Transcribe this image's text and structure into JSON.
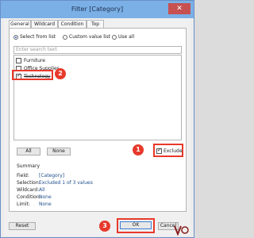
{
  "window": {
    "title": "Filter [Category]",
    "close_glyph": "✕"
  },
  "tabs": [
    "General",
    "Wildcard",
    "Condition",
    "Top"
  ],
  "mode": {
    "options": [
      "Select from list",
      "Custom value list",
      "Use all"
    ],
    "selected": "Select from list"
  },
  "search": {
    "placeholder": "Enter search text"
  },
  "items": [
    {
      "label": "Furniture",
      "checked": false
    },
    {
      "label": "Office Supplies",
      "checked": false
    },
    {
      "label": "Technology",
      "checked": true
    }
  ],
  "list_buttons": {
    "all": "All",
    "none": "None"
  },
  "exclude": {
    "label": "Exclude",
    "checked": true
  },
  "summary": {
    "heading": "Summary",
    "rows": [
      {
        "key": "Field:",
        "value": "[Category]"
      },
      {
        "key": "Selection:",
        "value": "Excluded 1 of 3 values"
      },
      {
        "key": "Wildcard:",
        "value": "All"
      },
      {
        "key": "Condition:",
        "value": "None"
      },
      {
        "key": "Limit:",
        "value": "None"
      }
    ]
  },
  "footer": {
    "reset": "Reset",
    "ok": "OK",
    "cancel": "Cancel"
  },
  "annotations": [
    "1",
    "2",
    "3"
  ],
  "colors": {
    "titlebar": "#7ab0e6",
    "annotation": "#e8392b",
    "link_value": "#1f4e8c"
  }
}
